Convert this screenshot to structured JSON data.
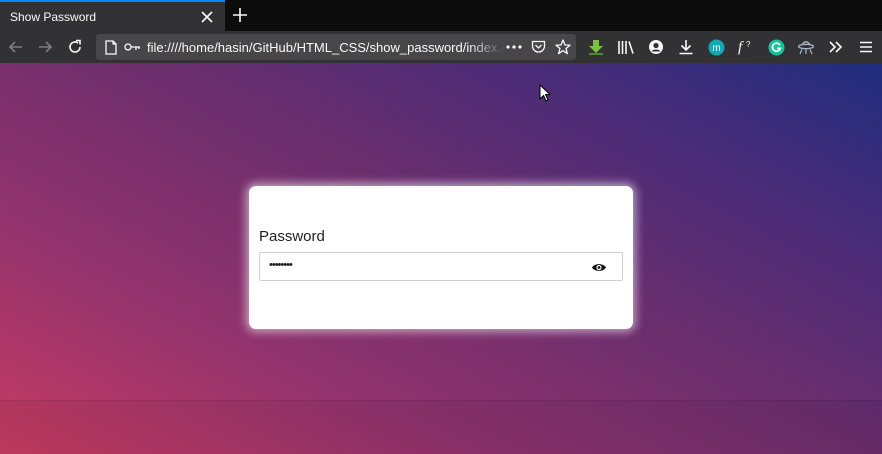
{
  "tab": {
    "title": "Show Password"
  },
  "navbar": {
    "url": "file:////home/hasin/GitHub/HTML_CSS/show_password/index.html"
  },
  "form": {
    "password_label": "Password",
    "password_value": "••••••••"
  },
  "icons": {
    "close": "close-icon",
    "new_tab": "plus-icon",
    "back": "back-arrow-icon",
    "forward": "forward-arrow-icon",
    "reload": "reload-icon",
    "page": "page-icon",
    "key": "key-icon",
    "more": "more-dots-icon",
    "pocket": "pocket-icon",
    "bookmark": "star-icon",
    "extension_download": "green-download-icon",
    "library": "library-icon",
    "account": "account-icon",
    "downloads": "download-icon",
    "extension_m": "m-extension-icon",
    "extension_f": "formula-icon",
    "grammarly": "grammarly-icon",
    "ufo": "ufo-icon",
    "overflow": "chevron-overflow-icon",
    "menu": "hamburger-menu-icon",
    "eye": "eye-icon"
  },
  "colors": {
    "tab_accent": "#0a84ff",
    "gradient_start": "#c73b62",
    "gradient_end": "#1f2d7e",
    "card": "#ffffff",
    "grammarly": "#15c39a",
    "m_extension": "#14a9b6"
  }
}
